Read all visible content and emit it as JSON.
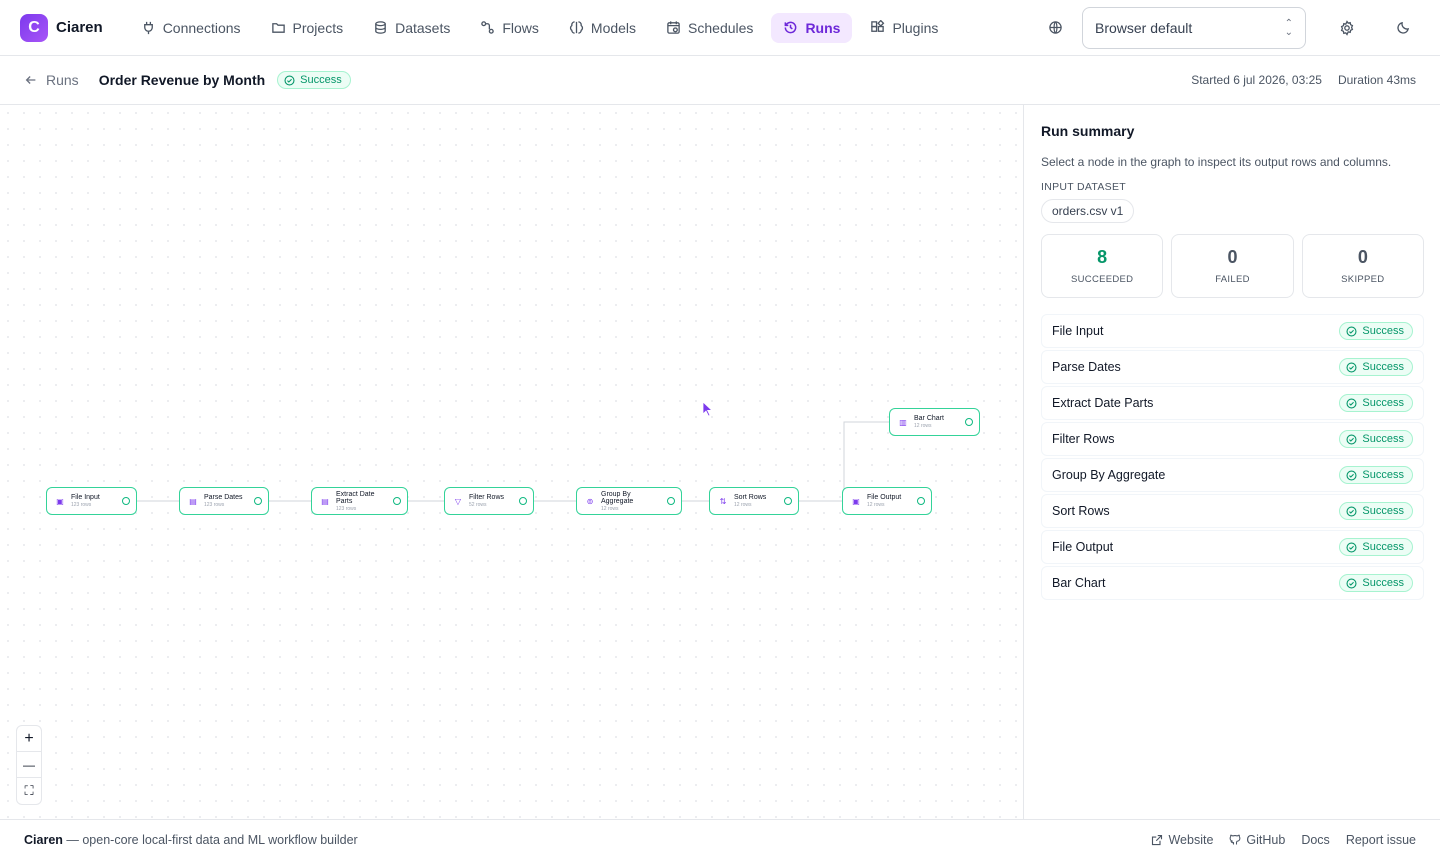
{
  "brand": {
    "name": "Ciaren",
    "logo_letter": "C"
  },
  "nav": [
    {
      "label": "Connections",
      "icon": "plug-icon"
    },
    {
      "label": "Projects",
      "icon": "folder-icon"
    },
    {
      "label": "Datasets",
      "icon": "database-icon"
    },
    {
      "label": "Flows",
      "icon": "flow-icon"
    },
    {
      "label": "Models",
      "icon": "brain-icon"
    },
    {
      "label": "Schedules",
      "icon": "calendar-clock-icon"
    },
    {
      "label": "Runs",
      "icon": "history-icon",
      "active": true
    },
    {
      "label": "Plugins",
      "icon": "puzzle-icon"
    }
  ],
  "language_select": {
    "value": "Browser default"
  },
  "header": {
    "back_label": "Runs",
    "title": "Order Revenue by Month",
    "status": "Success",
    "started": "Started 6 jul 2026, 03:25",
    "duration": "Duration 43ms"
  },
  "graph": {
    "nodes": [
      {
        "label": "File Input",
        "rows": "123 rows"
      },
      {
        "label": "Parse Dates",
        "rows": "123 rows"
      },
      {
        "label": "Extract Date Parts",
        "rows": "123 rows"
      },
      {
        "label": "Filter Rows",
        "rows": "52 rows"
      },
      {
        "label": "Group By Aggregate",
        "rows": "12 rows"
      },
      {
        "label": "Sort Rows",
        "rows": "12 rows"
      },
      {
        "label": "File Output",
        "rows": "12 rows"
      },
      {
        "label": "Bar Chart",
        "rows": "12 rows"
      }
    ],
    "zoom": {
      "in": "+",
      "out": "—",
      "fit": "⛶"
    }
  },
  "summary": {
    "title": "Run summary",
    "hint": "Select a node in the graph to inspect its output rows and columns.",
    "input_label": "INPUT DATASET",
    "input_dataset": "orders.csv v1",
    "stats": [
      {
        "value": "8",
        "label": "SUCCEEDED"
      },
      {
        "value": "0",
        "label": "FAILED"
      },
      {
        "value": "0",
        "label": "SKIPPED"
      }
    ],
    "steps": [
      {
        "name": "File Input",
        "status": "Success"
      },
      {
        "name": "Parse Dates",
        "status": "Success"
      },
      {
        "name": "Extract Date Parts",
        "status": "Success"
      },
      {
        "name": "Filter Rows",
        "status": "Success"
      },
      {
        "name": "Group By Aggregate",
        "status": "Success"
      },
      {
        "name": "Sort Rows",
        "status": "Success"
      },
      {
        "name": "File Output",
        "status": "Success"
      },
      {
        "name": "Bar Chart",
        "status": "Success"
      }
    ]
  },
  "footer": {
    "brand": "Ciaren",
    "tagline": " — open-core local-first data and ML workflow builder",
    "links": [
      "Website",
      "GitHub",
      "Docs",
      "Report issue"
    ]
  },
  "colors": {
    "accent": "#7c3aed",
    "success": "#10b981"
  }
}
